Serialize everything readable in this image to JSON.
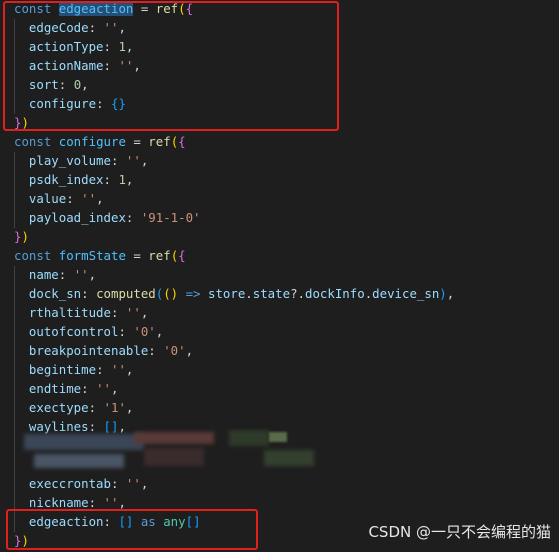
{
  "editor": {
    "lines": [
      [
        {
          "c": "kw",
          "t": "const "
        },
        {
          "c": "var hl",
          "t": "edgeaction"
        },
        {
          "c": "op",
          "t": " = "
        },
        {
          "c": "fn",
          "t": "ref"
        },
        {
          "c": "b1",
          "t": "("
        },
        {
          "c": "b2",
          "t": "{"
        }
      ],
      [
        {
          "c": "op",
          "t": "  "
        },
        {
          "c": "prop",
          "t": "edgeCode"
        },
        {
          "c": "op",
          "t": ": "
        },
        {
          "c": "str",
          "t": "''"
        },
        {
          "c": "op",
          "t": ","
        }
      ],
      [
        {
          "c": "op",
          "t": "  "
        },
        {
          "c": "prop",
          "t": "actionType"
        },
        {
          "c": "op",
          "t": ": "
        },
        {
          "c": "num",
          "t": "1"
        },
        {
          "c": "op",
          "t": ","
        }
      ],
      [
        {
          "c": "op",
          "t": "  "
        },
        {
          "c": "prop",
          "t": "actionName"
        },
        {
          "c": "op",
          "t": ": "
        },
        {
          "c": "str",
          "t": "''"
        },
        {
          "c": "op",
          "t": ","
        }
      ],
      [
        {
          "c": "op",
          "t": "  "
        },
        {
          "c": "prop",
          "t": "sort"
        },
        {
          "c": "op",
          "t": ": "
        },
        {
          "c": "num",
          "t": "0"
        },
        {
          "c": "op",
          "t": ","
        }
      ],
      [
        {
          "c": "op",
          "t": "  "
        },
        {
          "c": "prop",
          "t": "configure"
        },
        {
          "c": "op",
          "t": ": "
        },
        {
          "c": "b3",
          "t": "{}"
        }
      ],
      [
        {
          "c": "b2",
          "t": "}"
        },
        {
          "c": "b1",
          "t": ")"
        }
      ],
      [
        {
          "c": "kw",
          "t": "const "
        },
        {
          "c": "var",
          "t": "configure"
        },
        {
          "c": "op",
          "t": " = "
        },
        {
          "c": "fn",
          "t": "ref"
        },
        {
          "c": "b1",
          "t": "("
        },
        {
          "c": "b2",
          "t": "{"
        }
      ],
      [
        {
          "c": "op",
          "t": "  "
        },
        {
          "c": "prop",
          "t": "play_volume"
        },
        {
          "c": "op",
          "t": ": "
        },
        {
          "c": "str",
          "t": "''"
        },
        {
          "c": "op",
          "t": ","
        }
      ],
      [
        {
          "c": "op",
          "t": "  "
        },
        {
          "c": "prop",
          "t": "psdk_index"
        },
        {
          "c": "op",
          "t": ": "
        },
        {
          "c": "num",
          "t": "1"
        },
        {
          "c": "op",
          "t": ","
        }
      ],
      [
        {
          "c": "op",
          "t": "  "
        },
        {
          "c": "prop",
          "t": "value"
        },
        {
          "c": "op",
          "t": ": "
        },
        {
          "c": "str",
          "t": "''"
        },
        {
          "c": "op",
          "t": ","
        }
      ],
      [
        {
          "c": "op",
          "t": "  "
        },
        {
          "c": "prop",
          "t": "payload_index"
        },
        {
          "c": "op",
          "t": ": "
        },
        {
          "c": "str",
          "t": "'91-1-0'"
        }
      ],
      [
        {
          "c": "b2",
          "t": "}"
        },
        {
          "c": "b1",
          "t": ")"
        }
      ],
      [
        {
          "c": "kw",
          "t": "const "
        },
        {
          "c": "var",
          "t": "formState"
        },
        {
          "c": "op",
          "t": " = "
        },
        {
          "c": "fn",
          "t": "ref"
        },
        {
          "c": "b1",
          "t": "("
        },
        {
          "c": "b2",
          "t": "{"
        }
      ],
      [
        {
          "c": "op",
          "t": "  "
        },
        {
          "c": "prop",
          "t": "name"
        },
        {
          "c": "op",
          "t": ": "
        },
        {
          "c": "str",
          "t": "''"
        },
        {
          "c": "op",
          "t": ","
        }
      ],
      [
        {
          "c": "op",
          "t": "  "
        },
        {
          "c": "prop",
          "t": "dock_sn"
        },
        {
          "c": "op",
          "t": ": "
        },
        {
          "c": "fn",
          "t": "computed"
        },
        {
          "c": "b3",
          "t": "("
        },
        {
          "c": "b1",
          "t": "()"
        },
        {
          "c": "kw",
          "t": " => "
        },
        {
          "c": "prop",
          "t": "store"
        },
        {
          "c": "op",
          "t": "."
        },
        {
          "c": "prop",
          "t": "state"
        },
        {
          "c": "op",
          "t": "?."
        },
        {
          "c": "prop",
          "t": "dockInfo"
        },
        {
          "c": "op",
          "t": "."
        },
        {
          "c": "prop",
          "t": "device_sn"
        },
        {
          "c": "b3",
          "t": ")"
        },
        {
          "c": "op",
          "t": ","
        }
      ],
      [
        {
          "c": "op",
          "t": "  "
        },
        {
          "c": "prop",
          "t": "rthaltitude"
        },
        {
          "c": "op",
          "t": ": "
        },
        {
          "c": "str",
          "t": "''"
        },
        {
          "c": "op",
          "t": ","
        }
      ],
      [
        {
          "c": "op",
          "t": "  "
        },
        {
          "c": "prop",
          "t": "outofcontrol"
        },
        {
          "c": "op",
          "t": ": "
        },
        {
          "c": "str",
          "t": "'0'"
        },
        {
          "c": "op",
          "t": ","
        }
      ],
      [
        {
          "c": "op",
          "t": "  "
        },
        {
          "c": "prop",
          "t": "breakpointenable"
        },
        {
          "c": "op",
          "t": ": "
        },
        {
          "c": "str",
          "t": "'0'"
        },
        {
          "c": "op",
          "t": ","
        }
      ],
      [
        {
          "c": "op",
          "t": "  "
        },
        {
          "c": "prop",
          "t": "begintime"
        },
        {
          "c": "op",
          "t": ": "
        },
        {
          "c": "str",
          "t": "''"
        },
        {
          "c": "op",
          "t": ","
        }
      ],
      [
        {
          "c": "op",
          "t": "  "
        },
        {
          "c": "prop",
          "t": "endtime"
        },
        {
          "c": "op",
          "t": ": "
        },
        {
          "c": "str",
          "t": "''"
        },
        {
          "c": "op",
          "t": ","
        }
      ],
      [
        {
          "c": "op",
          "t": "  "
        },
        {
          "c": "prop",
          "t": "exectype"
        },
        {
          "c": "op",
          "t": ": "
        },
        {
          "c": "str",
          "t": "'1'"
        },
        {
          "c": "op",
          "t": ","
        }
      ],
      [
        {
          "c": "op",
          "t": "  "
        },
        {
          "c": "prop",
          "t": "waylines"
        },
        {
          "c": "op",
          "t": ": "
        },
        {
          "c": "b3",
          "t": "[]"
        },
        {
          "c": "op",
          "t": ","
        }
      ],
      [],
      [],
      [
        {
          "c": "op",
          "t": "  "
        },
        {
          "c": "prop",
          "t": "execcrontab"
        },
        {
          "c": "op",
          "t": ": "
        },
        {
          "c": "str",
          "t": "''"
        },
        {
          "c": "op",
          "t": ","
        }
      ],
      [
        {
          "c": "op",
          "t": "  "
        },
        {
          "c": "prop",
          "t": "nickname"
        },
        {
          "c": "op",
          "t": ": "
        },
        {
          "c": "str",
          "t": "''"
        },
        {
          "c": "op",
          "t": ","
        }
      ],
      [
        {
          "c": "op",
          "t": "  "
        },
        {
          "c": "prop",
          "t": "edgeaction"
        },
        {
          "c": "op",
          "t": ": "
        },
        {
          "c": "b3",
          "t": "[]"
        },
        {
          "c": "kw",
          "t": " as "
        },
        {
          "c": "typ",
          "t": "any"
        },
        {
          "c": "b3",
          "t": "[]"
        }
      ],
      [
        {
          "c": "b2",
          "t": "}"
        },
        {
          "c": "b1",
          "t": ")"
        }
      ]
    ]
  },
  "watermark": "CSDN @一只不会编程的猫",
  "colors": {
    "background": "#1e1e1e",
    "highlight_box": "#e0201f",
    "keyword": "#569cd6",
    "string": "#ce9178",
    "number": "#b5cea8",
    "property": "#9cdcfe",
    "function": "#dcdcaa"
  }
}
